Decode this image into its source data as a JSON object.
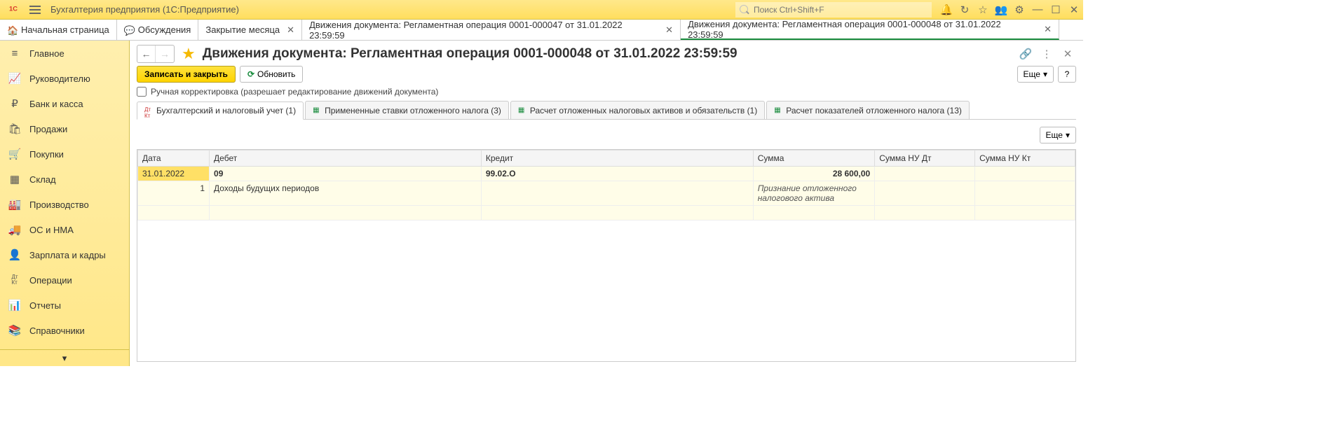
{
  "titlebar": {
    "app_title": "Бухгалтерия предприятия  (1С:Предприятие)",
    "search_placeholder": "Поиск Ctrl+Shift+F"
  },
  "tabs": [
    {
      "label": "Начальная страница",
      "closable": false,
      "icon": "home"
    },
    {
      "label": "Обсуждения",
      "closable": false,
      "icon": "chat"
    },
    {
      "label": "Закрытие месяца",
      "closable": true
    },
    {
      "label": "Движения документа: Регламентная операция 0001-000047 от 31.01.2022 23:59:59",
      "closable": true
    },
    {
      "label": "Движения документа: Регламентная операция 0001-000048 от 31.01.2022 23:59:59",
      "closable": true,
      "active": true
    }
  ],
  "sidebar": [
    {
      "label": "Главное",
      "icon": "≡"
    },
    {
      "label": "Руководителю",
      "icon": "📈"
    },
    {
      "label": "Банк и касса",
      "icon": "₽"
    },
    {
      "label": "Продажи",
      "icon": "🛍"
    },
    {
      "label": "Покупки",
      "icon": "🛒"
    },
    {
      "label": "Склад",
      "icon": "▦"
    },
    {
      "label": "Производство",
      "icon": "🏭"
    },
    {
      "label": "ОС и НМА",
      "icon": "🚚"
    },
    {
      "label": "Зарплата и кадры",
      "icon": "👤"
    },
    {
      "label": "Операции",
      "icon": "ДтКт"
    },
    {
      "label": "Отчеты",
      "icon": "📊"
    },
    {
      "label": "Справочники",
      "icon": "📚"
    }
  ],
  "doc": {
    "title": "Движения документа: Регламентная операция 0001-000048 от 31.01.2022 23:59:59"
  },
  "toolbar": {
    "save_close": "Записать и закрыть",
    "refresh": "Обновить",
    "more": "Еще",
    "help": "?"
  },
  "manual_edit_label": "Ручная корректировка (разрешает редактирование движений документа)",
  "subtabs": [
    {
      "label": "Бухгалтерский и налоговый учет (1)",
      "active": true,
      "icon_color": "red"
    },
    {
      "label": "Примененные ставки отложенного налога (3)",
      "icon_color": "green"
    },
    {
      "label": "Расчет отложенных налоговых активов и обязательств (1)",
      "icon_color": "green"
    },
    {
      "label": "Расчет показателей отложенного налога (13)",
      "icon_color": "green"
    }
  ],
  "table": {
    "headers": [
      "Дата",
      "Дебет",
      "Кредит",
      "Сумма",
      "Сумма НУ Дт",
      "Сумма НУ Кт"
    ],
    "row1": {
      "date": "31.01.2022",
      "debit": "09",
      "credit": "99.02.О",
      "amount": "28 600,00"
    },
    "row2": {
      "num": "1",
      "debit_desc": "Доходы будущих периодов",
      "note": "Признание отложенного налогового актива"
    }
  },
  "more_label": "Еще"
}
